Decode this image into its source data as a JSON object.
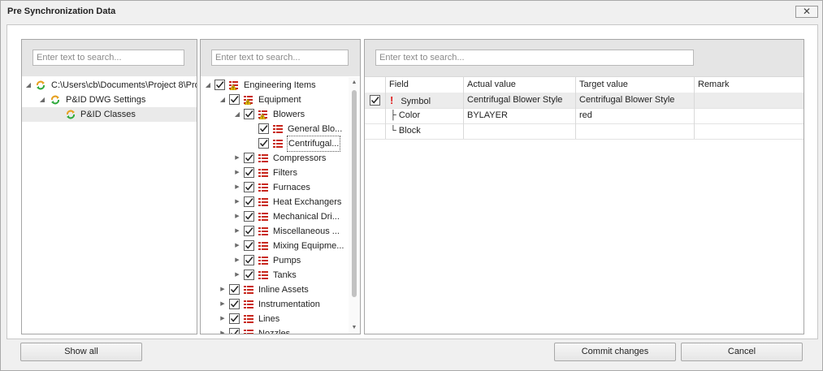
{
  "window": {
    "title": "Pre Synchronization Data",
    "close_glyph": "✕"
  },
  "left_panel": {
    "search_placeholder": "Enter text to search...",
    "items": [
      {
        "label": "C:\\Users\\cb\\Documents\\Project 8\\Pro",
        "icon": "sync-icon"
      },
      {
        "label": "P&ID DWG Settings",
        "icon": "sync-icon"
      },
      {
        "label": "P&ID Classes",
        "icon": "sync-icon"
      }
    ]
  },
  "middle_panel": {
    "search_placeholder": "Enter text to search...",
    "items": [
      {
        "label": "Engineering Items",
        "icon": "warning-list-icon"
      },
      {
        "label": "Equipment",
        "icon": "warning-list-icon"
      },
      {
        "label": "Blowers",
        "icon": "warning-list-icon"
      },
      {
        "label": "General Blo...",
        "icon": "class-list-icon"
      },
      {
        "label": "Centrifugal...",
        "icon": "class-list-icon"
      },
      {
        "label": "Compressors",
        "icon": "class-list-icon"
      },
      {
        "label": "Filters",
        "icon": "class-list-icon"
      },
      {
        "label": "Furnaces",
        "icon": "class-list-icon"
      },
      {
        "label": "Heat Exchangers",
        "icon": "class-list-icon"
      },
      {
        "label": "Mechanical Dri...",
        "icon": "class-list-icon"
      },
      {
        "label": "Miscellaneous ...",
        "icon": "class-list-icon"
      },
      {
        "label": "Mixing Equipme...",
        "icon": "class-list-icon"
      },
      {
        "label": "Pumps",
        "icon": "class-list-icon"
      },
      {
        "label": "Tanks",
        "icon": "class-list-icon"
      },
      {
        "label": "Inline Assets",
        "icon": "class-list-icon"
      },
      {
        "label": "Instrumentation",
        "icon": "class-list-icon"
      },
      {
        "label": "Lines",
        "icon": "class-list-icon"
      },
      {
        "label": "Nozzles",
        "icon": "class-list-icon"
      }
    ]
  },
  "right_panel": {
    "search_placeholder": "Enter text to search...",
    "columns": [
      "Field",
      "Actual value",
      "Target value",
      "Remark"
    ],
    "rows": [
      {
        "checked": true,
        "warning": "!",
        "field": "Symbol",
        "actual": "Centrifugal Blower Style",
        "target": "Centrifugal Blower Style",
        "remark": ""
      },
      {
        "checked": false,
        "warning": "",
        "field": "├ Color",
        "actual": "BYLAYER",
        "target": "red",
        "remark": ""
      },
      {
        "checked": false,
        "warning": "",
        "field": "└ Block",
        "actual": "",
        "target": "",
        "remark": ""
      }
    ]
  },
  "buttons": {
    "show_all": "Show all",
    "commit": "Commit changes",
    "cancel": "Cancel"
  },
  "colors": {
    "warning": "#e02020",
    "sync_green": "#2eaa3c",
    "sync_orange": "#e6a020",
    "list_red": "#c8281e"
  }
}
